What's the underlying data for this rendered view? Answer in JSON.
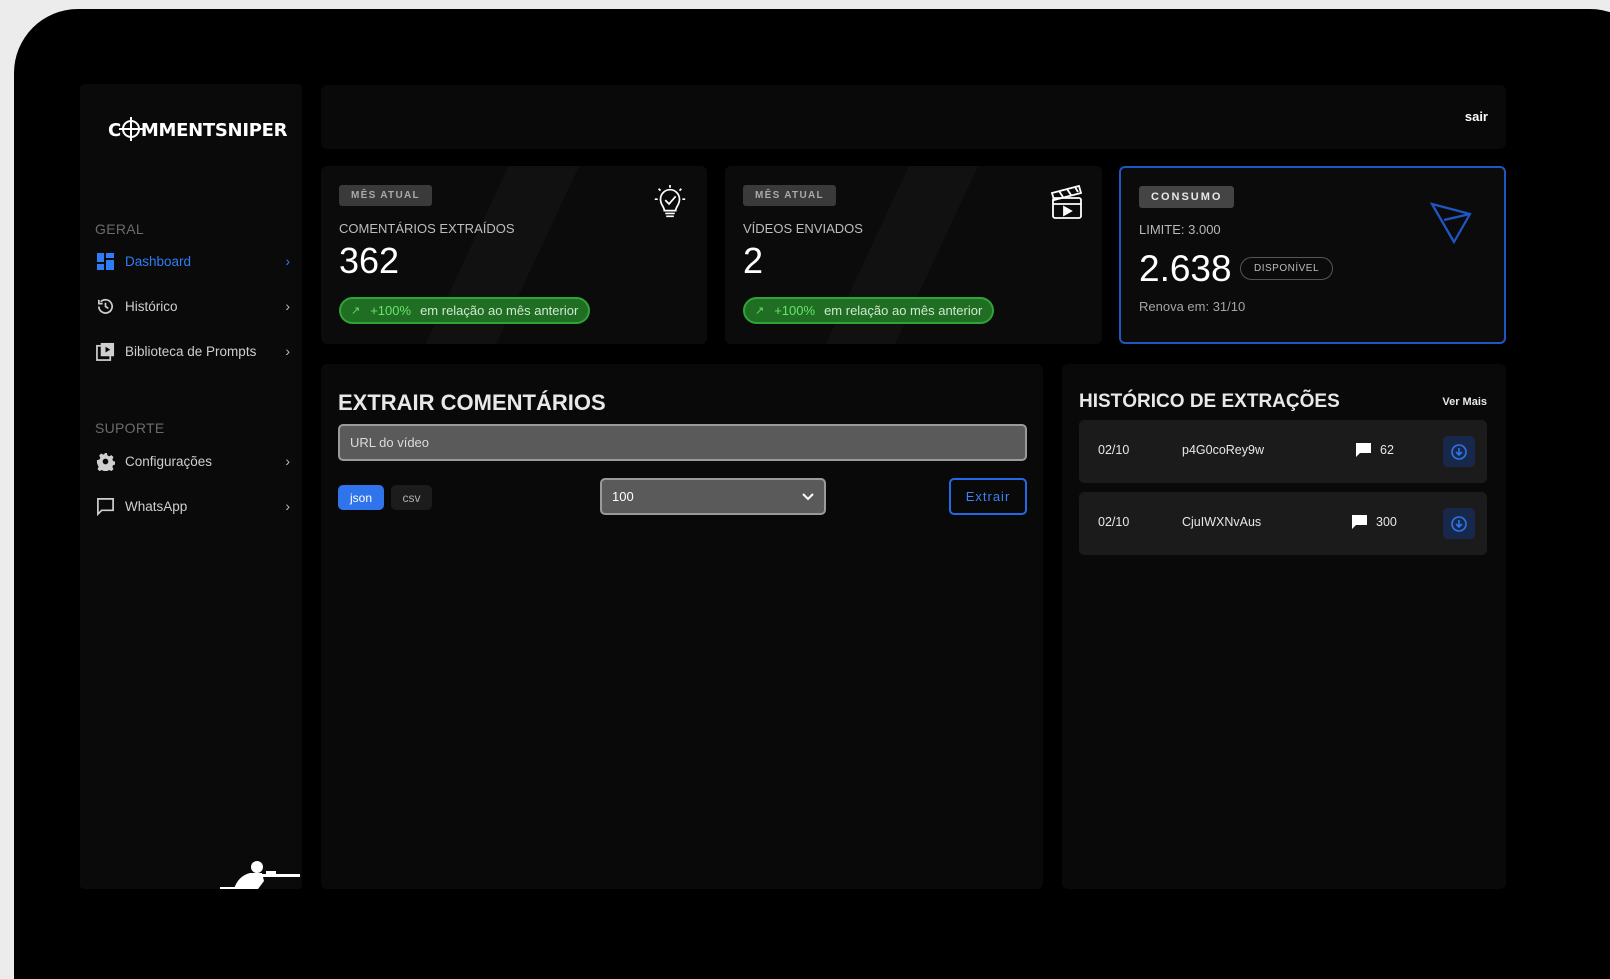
{
  "brand": {
    "logo_before": "C",
    "logo_after": "MMENTSNIPER"
  },
  "sidebar": {
    "section_general": "GERAL",
    "section_support": "SUPORTE",
    "items": [
      {
        "label": "Dashboard",
        "icon": "dashboard-grid-icon"
      },
      {
        "label": "Histórico",
        "icon": "history-icon"
      },
      {
        "label": "Biblioteca de Prompts",
        "icon": "library-play-icon"
      },
      {
        "label": "Configurações",
        "icon": "gear-icon"
      },
      {
        "label": "WhatsApp",
        "icon": "chat-icon"
      }
    ]
  },
  "topbar": {
    "logout_label": "sair"
  },
  "stats": {
    "comments": {
      "badge": "MÊS ATUAL",
      "label": "COMENTÁRIOS EXTRAÍDOS",
      "value": "362",
      "growth_pct": "+100%",
      "growth_text": "em relação ao mês anterior",
      "icon": "lightbulb-icon"
    },
    "videos": {
      "badge": "MÊS ATUAL",
      "label": "VÍDEOS ENVIADOS",
      "value": "2",
      "growth_pct": "+100%",
      "growth_text": "em relação ao mês anterior",
      "icon": "clapperboard-icon"
    },
    "usage": {
      "badge": "CONSUMO",
      "limit": "LIMITE: 3.000",
      "value": "2.638",
      "status": "DISPONÍVEL",
      "renew": "Renova em: 31/10",
      "icon": "send-icon"
    }
  },
  "extract": {
    "title": "EXTRAIR COMENTÁRIOS",
    "url_placeholder": "URL do vídeo",
    "format_json": "json",
    "format_csv": "csv",
    "quantity_value": "100",
    "submit_label": "Extrair"
  },
  "history": {
    "title": "HISTÓRICO DE EXTRAÇÕES",
    "see_more": "Ver Mais",
    "rows": [
      {
        "date": "02/10",
        "video_id": "p4G0coRey9w",
        "count": "62"
      },
      {
        "date": "02/10",
        "video_id": "CjuIWXNvAus",
        "count": "300"
      }
    ]
  },
  "colors": {
    "accent": "#2f74ea",
    "success": "#2ea534",
    "background": "#000000",
    "panel": "#090909"
  }
}
